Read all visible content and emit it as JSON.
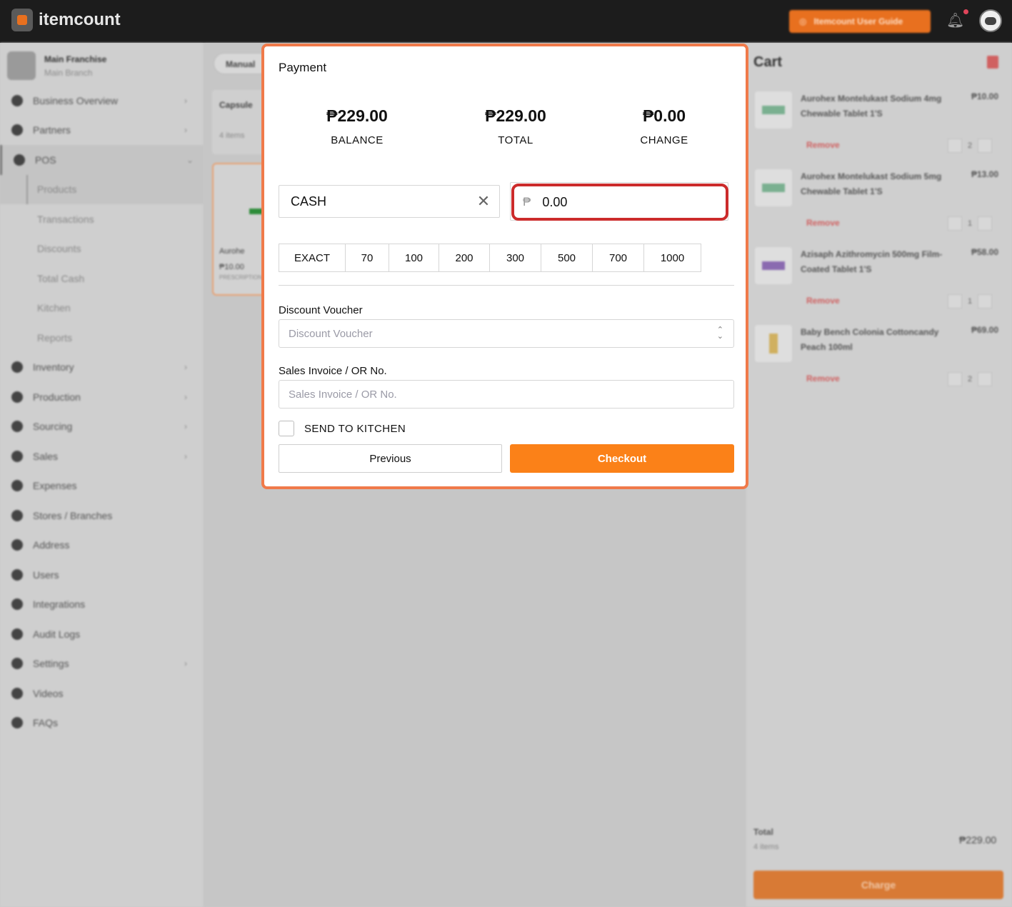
{
  "app": {
    "brand": "itemcount",
    "guide_button": "Itemcount User Guide",
    "branch": {
      "name": "Main Franchise",
      "sub": "Main Branch"
    }
  },
  "sidebar": {
    "items": [
      {
        "label": "Business Overview",
        "chevron": "›"
      },
      {
        "label": "Partners",
        "chevron": "›"
      },
      {
        "label": "POS",
        "chevron": "⌄"
      }
    ],
    "pos_sub": [
      "Products",
      "Transactions",
      "Discounts",
      "Total Cash",
      "Kitchen",
      "Reports"
    ],
    "items_after": [
      {
        "label": "Inventory",
        "chevron": "›"
      },
      {
        "label": "Production",
        "chevron": "›"
      },
      {
        "label": "Sourcing",
        "chevron": "›"
      },
      {
        "label": "Sales",
        "chevron": "›"
      },
      {
        "label": "Expenses",
        "chevron": ""
      },
      {
        "label": "Stores / Branches",
        "chevron": ""
      },
      {
        "label": "Address",
        "chevron": ""
      },
      {
        "label": "Users",
        "chevron": ""
      },
      {
        "label": "Integrations",
        "chevron": ""
      },
      {
        "label": "Audit Logs",
        "chevron": ""
      },
      {
        "label": "Settings",
        "chevron": "›"
      },
      {
        "label": "Videos",
        "chevron": ""
      },
      {
        "label": "FAQs",
        "chevron": ""
      }
    ]
  },
  "content": {
    "mode_pill": "Manual",
    "category": {
      "name": "Capsule",
      "count": "4 items"
    },
    "product": {
      "name": "Aurohe",
      "price": "₱10.00",
      "tag": "PRESCRIPTION"
    }
  },
  "cart": {
    "title": "Cart",
    "remove_label": "Remove",
    "items": [
      {
        "name": "Aurohex Montelukast Sodium 4mg Chewable Tablet 1'S",
        "price": "₱10.00",
        "qty": "2"
      },
      {
        "name": "Aurohex Montelukast Sodium 5mg Chewable Tablet 1'S",
        "price": "₱13.00",
        "qty": "1"
      },
      {
        "name": "Azisaph Azithromycin 500mg Film-Coated Tablet 1'S",
        "price": "₱58.00",
        "qty": "1"
      },
      {
        "name": "Baby Bench Colonia Cottoncandy Peach 100ml",
        "price": "₱69.00",
        "qty": "2"
      }
    ],
    "total_label": "Total",
    "total_items": "4 items",
    "total_value": "₱229.00",
    "charge_label": "Charge"
  },
  "payment": {
    "title": "Payment",
    "balance": {
      "value": "₱229.00",
      "label": "BALANCE"
    },
    "total": {
      "value": "₱229.00",
      "label": "TOTAL"
    },
    "change": {
      "value": "₱0.00",
      "label": "CHANGE"
    },
    "method": "CASH",
    "currency_symbol": "₱",
    "amount": "0.00",
    "quick_amounts": [
      "EXACT",
      "70",
      "100",
      "200",
      "300",
      "500",
      "700",
      "1000"
    ],
    "voucher_label": "Discount Voucher",
    "voucher_placeholder": "Discount Voucher",
    "invoice_label": "Sales Invoice / OR No.",
    "invoice_placeholder": "Sales Invoice / OR No.",
    "kitchen_label": "SEND TO KITCHEN",
    "previous_label": "Previous",
    "checkout_label": "Checkout"
  },
  "colors": {
    "accent": "#fb8118",
    "modal_border": "#f07a4a",
    "focus_ring": "#cc2b2b"
  },
  "icons": [
    "bulb-icon",
    "bell-icon",
    "clear-icon",
    "peso-icon",
    "updown-chevron-icon",
    "trash-icon"
  ]
}
